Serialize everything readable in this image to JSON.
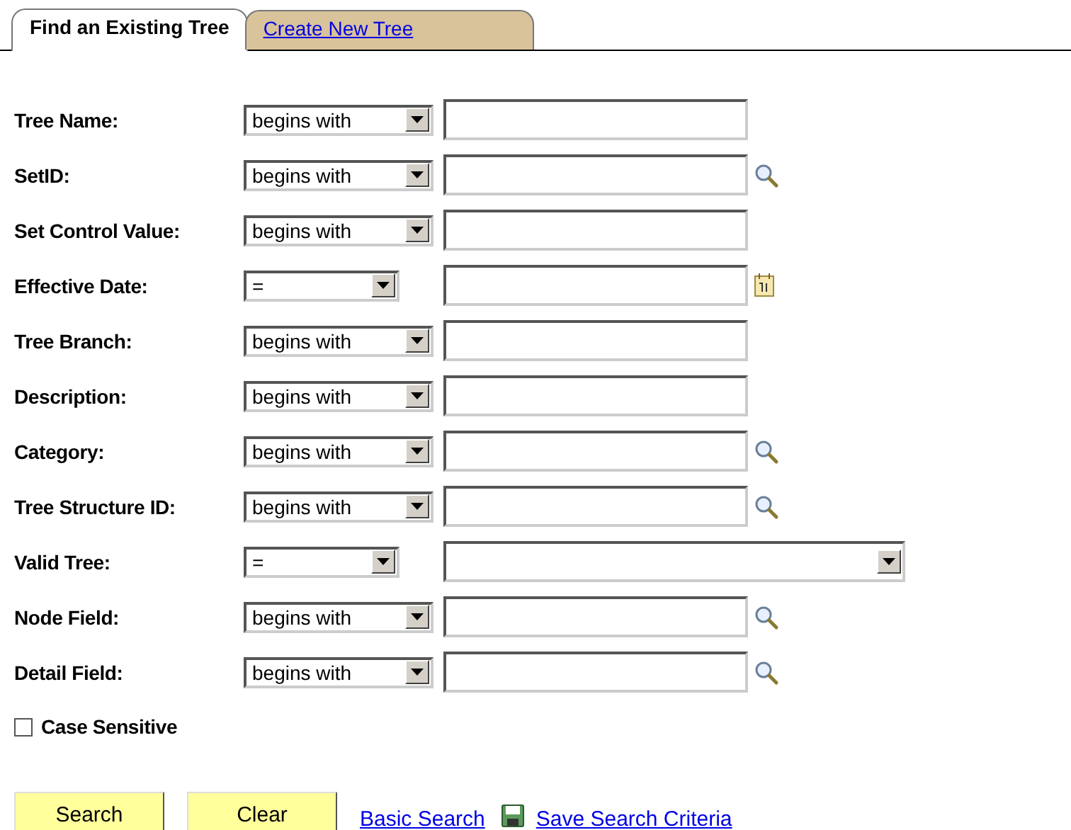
{
  "tabs": [
    {
      "label": "Find an Existing Tree",
      "selected": true
    },
    {
      "label": "Create New Tree",
      "selected": false
    }
  ],
  "criteria": [
    {
      "label": "Tree Name:",
      "operator": "begins with",
      "kind": "text"
    },
    {
      "label": "SetID:",
      "operator": "begins with",
      "kind": "lookup"
    },
    {
      "label": "Set Control Value:",
      "operator": "begins with",
      "kind": "text"
    },
    {
      "label": "Effective Date:",
      "operator": "=",
      "kind": "date"
    },
    {
      "label": "Tree Branch:",
      "operator": "begins with",
      "kind": "text"
    },
    {
      "label": "Description:",
      "operator": "begins with",
      "kind": "text"
    },
    {
      "label": "Category:",
      "operator": "begins with",
      "kind": "lookup"
    },
    {
      "label": "Tree Structure ID:",
      "operator": "begins with",
      "kind": "lookup"
    },
    {
      "label": "Valid Tree:",
      "operator": "=",
      "kind": "choice"
    },
    {
      "label": "Node Field:",
      "operator": "begins with",
      "kind": "lookup"
    },
    {
      "label": "Detail Field:",
      "operator": "begins with",
      "kind": "lookup"
    }
  ],
  "case_sensitive": {
    "label": "Case Sensitive",
    "checked": false
  },
  "buttons": [
    {
      "label": "Search"
    },
    {
      "label": "Clear"
    }
  ],
  "links": [
    {
      "label": "Basic Search",
      "kind": "plain"
    },
    {
      "label": "Save Search Criteria",
      "kind": "save"
    }
  ]
}
